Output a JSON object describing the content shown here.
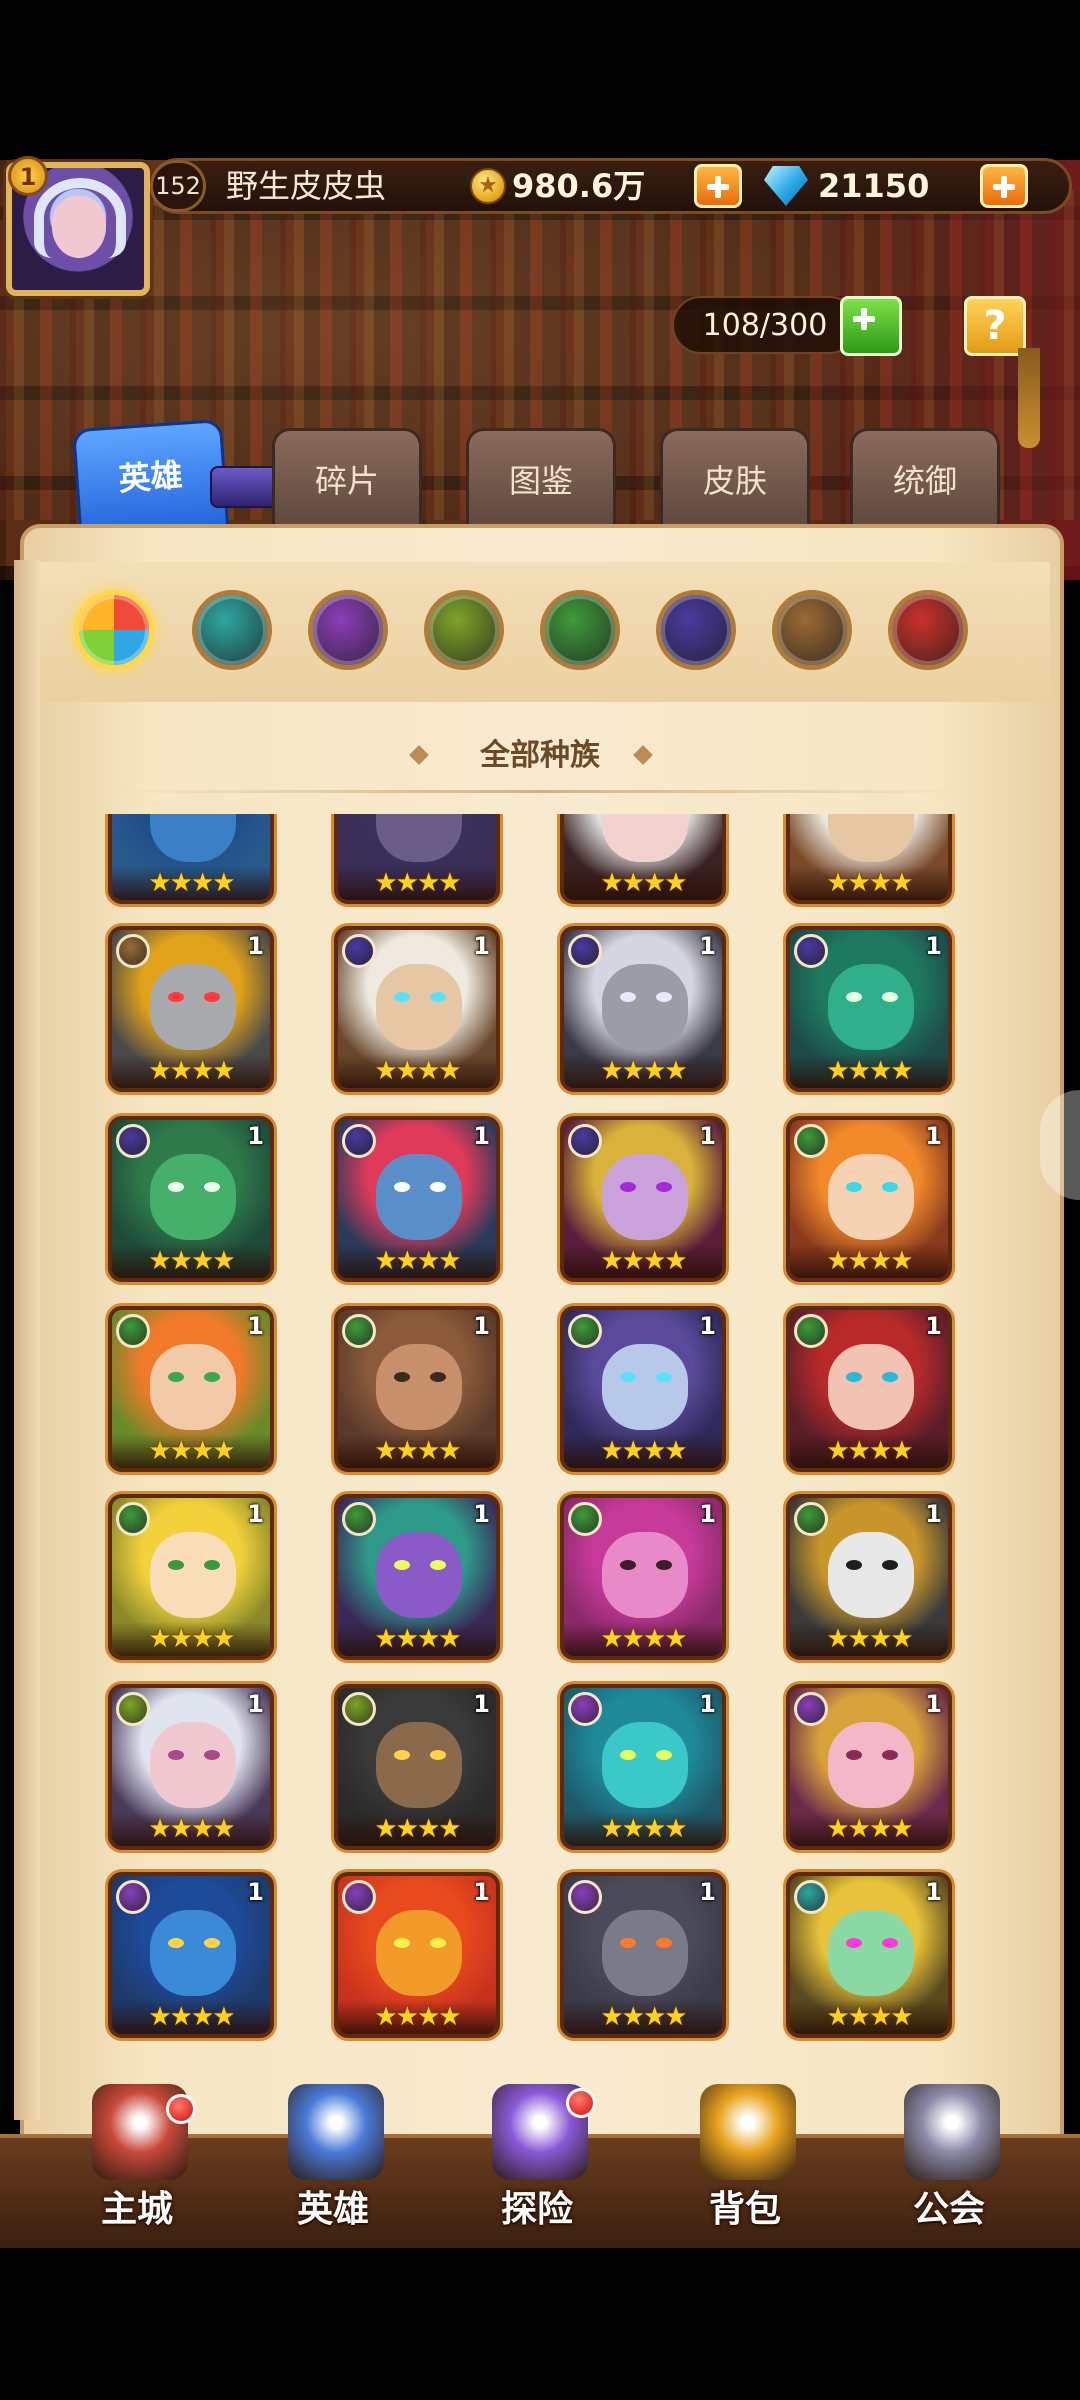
{
  "player": {
    "vip_level": "1",
    "level": "152",
    "name": "野生皮皮虫",
    "gold": "980.6万",
    "gems": "21150"
  },
  "hero_capacity": "108/300",
  "help_label": "?",
  "tabs": [
    {
      "label": "英雄",
      "active": true
    },
    {
      "label": "碎片",
      "active": false
    },
    {
      "label": "图鉴",
      "active": false
    },
    {
      "label": "皮肤",
      "active": false
    },
    {
      "label": "统御",
      "active": false
    }
  ],
  "factions": [
    {
      "name": "all-factions-icon",
      "color": "#f14a3a",
      "selected": true
    },
    {
      "name": "forest-winged-icon",
      "color": "#2fa6a0",
      "selected": false
    },
    {
      "name": "shadow-drop-icon",
      "color": "#8a3fb8",
      "selected": false
    },
    {
      "name": "eye-faction-icon",
      "color": "#7fa329",
      "selected": false
    },
    {
      "name": "leaf-faction-icon",
      "color": "#3f9a3a",
      "selected": false
    },
    {
      "name": "demon-faction-icon",
      "color": "#4b3a9e",
      "selected": false
    },
    {
      "name": "wheel-faction-icon",
      "color": "#9a6a34",
      "selected": false
    },
    {
      "name": "fire-faction-icon",
      "color": "#c8322a",
      "selected": false
    }
  ],
  "race_label": "全部种族",
  "hero_rows": [
    [
      {
        "faction_color": "#4a8a3a",
        "skin": "#3b7fc4",
        "hair": "#1e4e8a",
        "eye": "#ffd24a",
        "bg": "#2a5a8c",
        "count": "",
        "stars": "★★★★"
      },
      {
        "faction_color": "#4b3a9e",
        "skin": "#6a5d8a",
        "hair": "#3b2f5e",
        "eye": "#c23a6a",
        "bg": "#3a2e56",
        "count": "",
        "stars": "★★★★"
      },
      {
        "faction_color": "#8a3fb8",
        "skin": "#f2d2cf",
        "hair": "#e0e0e0",
        "eye": "#d22a2a",
        "bg": "#3a2222",
        "count": "",
        "stars": "★★★★"
      },
      {
        "faction_color": "#9a6a34",
        "skin": "#e7c6a3",
        "hair": "#ece8e0",
        "eye": "#4a6ac4",
        "bg": "#7a4a2a",
        "count": "",
        "stars": "★★★★"
      }
    ],
    [
      {
        "faction_color": "#9a6a34",
        "skin": "#a7a9ad",
        "hair": "#e0a21a",
        "eye": "#ff3a3a",
        "bg": "#4a4a4a",
        "count": "1",
        "stars": "★★★★"
      },
      {
        "faction_color": "#4b3a9e",
        "skin": "#e7c6a3",
        "hair": "#efeae0",
        "eye": "#5ae0ff",
        "bg": "#6a4a2e",
        "count": "1",
        "stars": "★★★★"
      },
      {
        "faction_color": "#4b3a9e",
        "skin": "#9a9ca8",
        "hair": "#d6d6e0",
        "eye": "#e8e8ff",
        "bg": "#3a3a48",
        "count": "1",
        "stars": "★★★★"
      },
      {
        "faction_color": "#4b3a9e",
        "skin": "#2fb08a",
        "hair": "#1e7a5e",
        "eye": "#e8ffe0",
        "bg": "#1e4a4a",
        "count": "1",
        "stars": "★★★★"
      }
    ],
    [
      {
        "faction_color": "#4b3a9e",
        "skin": "#45b06a",
        "hair": "#2e7a4a",
        "eye": "#f0fff0",
        "bg": "#1e4a3a",
        "count": "1",
        "stars": "★★★★"
      },
      {
        "faction_color": "#4b3a9e",
        "skin": "#5a8ec8",
        "hair": "#e03a5a",
        "eye": "#ffffff",
        "bg": "#2a3a5a",
        "count": "1",
        "stars": "★★★★"
      },
      {
        "faction_color": "#4b3a9e",
        "skin": "#c8a2d8",
        "hair": "#d8b23a",
        "eye": "#a22ad8",
        "bg": "#5a1e3a",
        "count": "1",
        "stars": "★★★★"
      },
      {
        "faction_color": "#3f9a3a",
        "skin": "#f6d2b4",
        "hair": "#f28a2a",
        "eye": "#3ad8e8",
        "bg": "#8a3a1e",
        "count": "1",
        "stars": "★★★★"
      }
    ],
    [
      {
        "faction_color": "#3f9a3a",
        "skin": "#f2caa8",
        "hair": "#f07a2a",
        "eye": "#3aa84a",
        "bg": "#6a8a2a",
        "count": "1",
        "stars": "★★★★"
      },
      {
        "faction_color": "#3f9a3a",
        "skin": "#c8906a",
        "hair": "#8a5a3a",
        "eye": "#3a2a1e",
        "bg": "#5a3a2a",
        "count": "1",
        "stars": "★★★★"
      },
      {
        "faction_color": "#3f9a3a",
        "skin": "#b8c8e8",
        "hair": "#5a4a9a",
        "eye": "#5ae0ff",
        "bg": "#2e2a5a",
        "count": "1",
        "stars": "★★★★"
      },
      {
        "faction_color": "#3f9a3a",
        "skin": "#f2c2b2",
        "hair": "#b82a2a",
        "eye": "#2ab8d8",
        "bg": "#5a1e2a",
        "count": "1",
        "stars": "★★★★"
      }
    ],
    [
      {
        "faction_color": "#3f9a3a",
        "skin": "#f8ddb8",
        "hair": "#f2d23a",
        "eye": "#3a9a3a",
        "bg": "#8a8a2a",
        "count": "1",
        "stars": "★★★★"
      },
      {
        "faction_color": "#3f9a3a",
        "skin": "#8a5ac8",
        "hair": "#2e9a8a",
        "eye": "#e8ff5a",
        "bg": "#3a2a5a",
        "count": "1",
        "stars": "★★★★"
      },
      {
        "faction_color": "#3f9a3a",
        "skin": "#e88ac8",
        "hair": "#c83a9a",
        "eye": "#3a1e2a",
        "bg": "#8a2a6a",
        "count": "1",
        "stars": "★★★★"
      },
      {
        "faction_color": "#3f9a3a",
        "skin": "#e8e8e8",
        "hair": "#c8962a",
        "eye": "#1e1e1e",
        "bg": "#3a3a3a",
        "count": "1",
        "stars": "★★★★"
      }
    ],
    [
      {
        "faction_color": "#7fa329",
        "skin": "#f2c8d0",
        "hair": "#dfe4ef",
        "eye": "#a84a8a",
        "bg": "#4a3a5a",
        "count": "1",
        "stars": "★★★★"
      },
      {
        "faction_color": "#7fa329",
        "skin": "#8a6a4a",
        "hair": "#3a3a3a",
        "eye": "#ffd24a",
        "bg": "#2a2a2a",
        "count": "1",
        "stars": "★★★★"
      },
      {
        "faction_color": "#8a3fb8",
        "skin": "#3ac8c8",
        "hair": "#1e8a9a",
        "eye": "#e8ff5a",
        "bg": "#1e5a6a",
        "count": "1",
        "stars": "★★★★"
      },
      {
        "faction_color": "#8a3fb8",
        "skin": "#f2b8c8",
        "hair": "#d8a23a",
        "eye": "#8a2a5a",
        "bg": "#6a2a4a",
        "count": "1",
        "stars": "★★★★"
      }
    ],
    [
      {
        "faction_color": "#8a3fb8",
        "skin": "#3a8ad8",
        "hair": "#1e4a9a",
        "eye": "#ffd24a",
        "bg": "#1e3a6a",
        "count": "1",
        "stars": "★★★★"
      },
      {
        "faction_color": "#8a3fb8",
        "skin": "#f29a2a",
        "hair": "#e84a1e",
        "eye": "#fff04a",
        "bg": "#c8321e",
        "count": "1",
        "stars": "★★★★"
      },
      {
        "faction_color": "#8a3fb8",
        "skin": "#7a7a88",
        "hair": "#4a4a5a",
        "eye": "#ff7a2a",
        "bg": "#3a3a48",
        "count": "1",
        "stars": "★★★★"
      },
      {
        "faction_color": "#2fa6a0",
        "skin": "#8ad8a2",
        "hair": "#e8c23a",
        "eye": "#ff3ad8",
        "bg": "#5a4a1e",
        "count": "1",
        "stars": "★★★★"
      }
    ]
  ],
  "bottom_nav": [
    {
      "label": "主城",
      "icon": "castle-icon",
      "color": "#c84a3a",
      "badge": true
    },
    {
      "label": "英雄",
      "icon": "hero-icon",
      "color": "#4a7ad8",
      "badge": false
    },
    {
      "label": "探险",
      "icon": "portal-icon",
      "color": "#8a5ad8",
      "badge": true
    },
    {
      "label": "背包",
      "icon": "backpack-icon",
      "color": "#e8a21e",
      "badge": false
    },
    {
      "label": "公会",
      "icon": "guild-tower-icon",
      "color": "#8a8aa8",
      "badge": false
    }
  ]
}
